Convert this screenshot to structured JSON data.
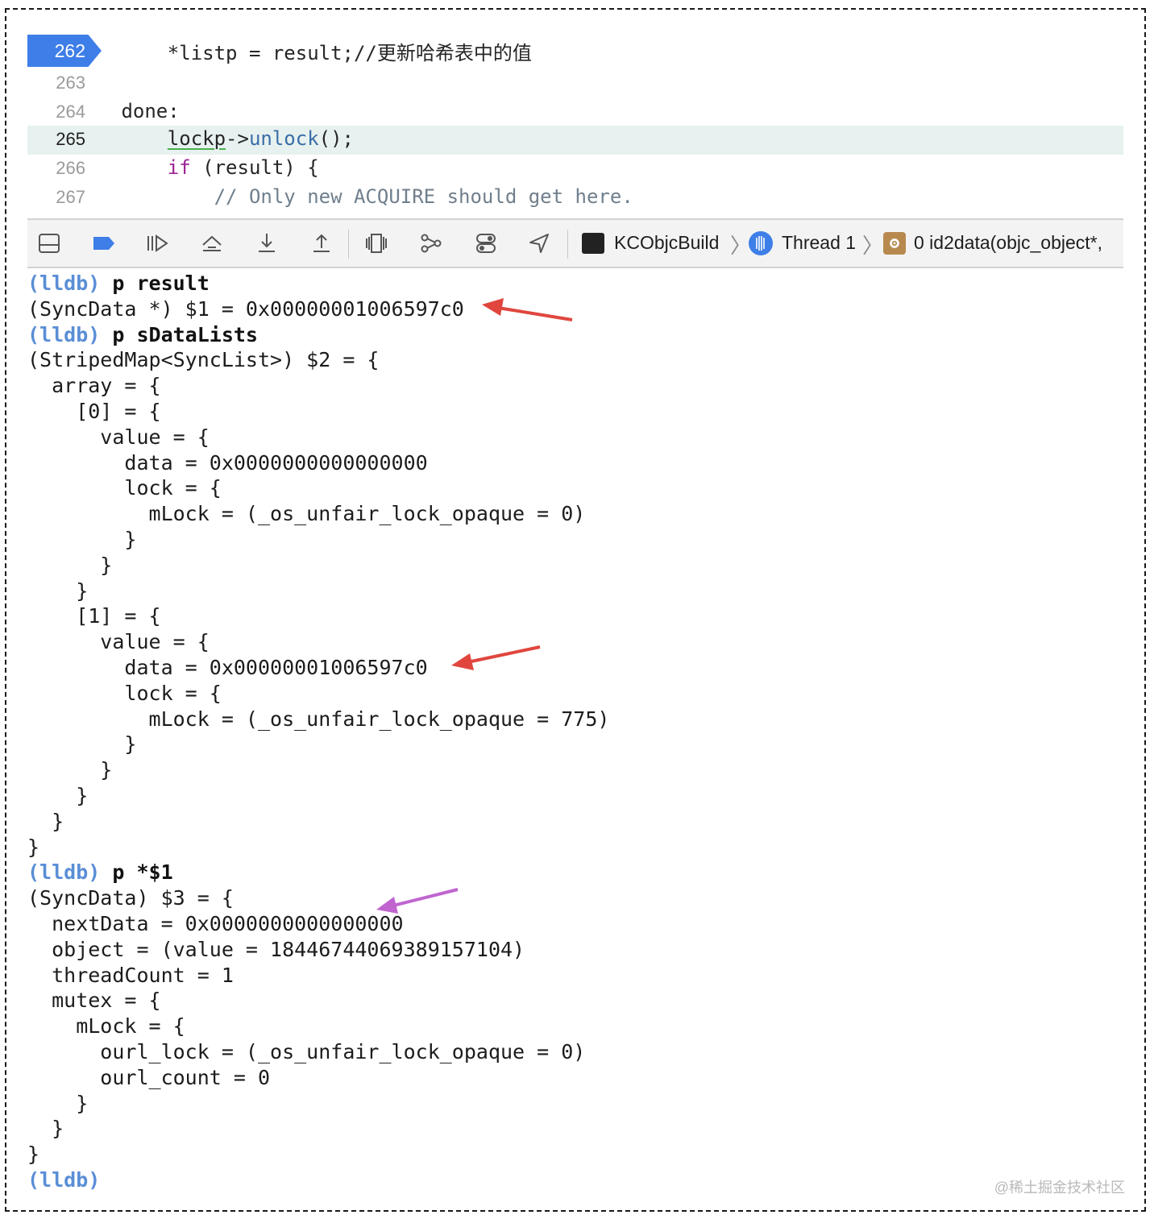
{
  "editor": {
    "lines": [
      {
        "num": "262",
        "text": "    *listp = result;//更新哈希表中的值"
      },
      {
        "num": "263",
        "text": ""
      },
      {
        "num": "264",
        "text": " done:"
      },
      {
        "num": "265",
        "text_pre": "    ",
        "text_a": "lockp",
        "text_b": "->",
        "text_c": "unlock",
        "text_d": "();"
      },
      {
        "num": "266",
        "text_pre": "    ",
        "kw": "if",
        "text_rest": " (result) {"
      },
      {
        "num": "267",
        "text": "        // Only new ACQUIRE should get here."
      }
    ]
  },
  "debug_bar": {
    "buttons": [
      "hide-console",
      "breakpoints-toggle",
      "continue",
      "step-over",
      "step-into",
      "step-out",
      "view-hierarchy",
      "memory-graph",
      "environment-overrides",
      "simulate-location"
    ],
    "target": "KCObjcBuild",
    "thread": "Thread 1",
    "frame": "0 id2data(objc_object*,"
  },
  "console": {
    "lines": [
      {
        "prompt": "(lldb)",
        "cmd": " p result"
      },
      {
        "text": "(SyncData *) $1 = 0x00000001006597c0"
      },
      {
        "prompt": "(lldb)",
        "cmd": " p sDataLists"
      },
      {
        "text": "(StripedMap<SyncList>) $2 = {"
      },
      {
        "text": "  array = {"
      },
      {
        "text": "    [0] = {"
      },
      {
        "text": "      value = {"
      },
      {
        "text": "        data = 0x0000000000000000"
      },
      {
        "text": "        lock = {"
      },
      {
        "text": "          mLock = (_os_unfair_lock_opaque = 0)"
      },
      {
        "text": "        }"
      },
      {
        "text": "      }"
      },
      {
        "text": "    }"
      },
      {
        "text": "    [1] = {"
      },
      {
        "text": "      value = {"
      },
      {
        "text": "        data = 0x00000001006597c0"
      },
      {
        "text": "        lock = {"
      },
      {
        "text": "          mLock = (_os_unfair_lock_opaque = 775)"
      },
      {
        "text": "        }"
      },
      {
        "text": "      }"
      },
      {
        "text": "    }"
      },
      {
        "text": "  }"
      },
      {
        "text": "}"
      },
      {
        "prompt": "(lldb)",
        "cmd": " p *$1"
      },
      {
        "text": "(SyncData) $3 = {"
      },
      {
        "text": "  nextData = 0x0000000000000000"
      },
      {
        "text": "  object = (value = 18446744069389157104)"
      },
      {
        "text": "  threadCount = 1"
      },
      {
        "text": "  mutex = {"
      },
      {
        "text": "    mLock = {"
      },
      {
        "text": "      ourl_lock = (_os_unfair_lock_opaque = 0)"
      },
      {
        "text": "      ourl_count = 0"
      },
      {
        "text": "    }"
      },
      {
        "text": "  }"
      },
      {
        "text": "}"
      },
      {
        "prompt": "(lldb)",
        "cmd": ""
      }
    ]
  },
  "annotations": {
    "arrow_colors": [
      "#e0463e",
      "#e0463e",
      "#c065d0"
    ]
  },
  "watermark": "@稀土掘金技术社区"
}
